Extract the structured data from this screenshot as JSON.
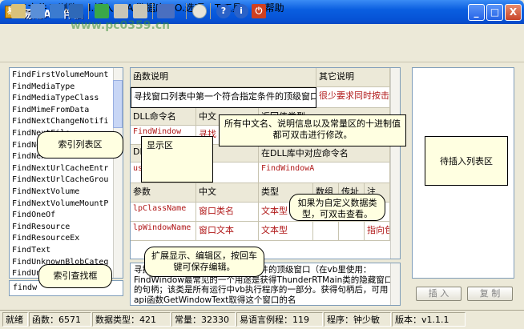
{
  "window": {
    "title": "易用API伴侣",
    "minimize": "_",
    "maximize": "□",
    "close": "X"
  },
  "menu": [
    "F.文件",
    "V.浏览",
    "I.插入",
    "A.数据库",
    "O.选项",
    "T.工具",
    "H.帮助"
  ],
  "watermark": "www.pc0359.cn",
  "index_list": [
    "FindFirstVolumeMount",
    "FindMediaType",
    "FindMediaTypeClass",
    "FindMimeFromData",
    "FindNextChangeNotifi",
    "FindNextFile",
    "FindNextFileA",
    "FindNextFileW",
    "FindNextUrlCacheEntr",
    "FindNextUrlCacheGrou",
    "FindNextVolume",
    "FindNextVolumeMountP",
    "FindOneOf",
    "FindResource",
    "FindResourceEx",
    "FindText",
    "FindUnknownBlobCateg",
    "FindUnknown"
  ],
  "search_value": "findw",
  "function_table": {
    "desc_header": "函数说明",
    "other_header": "其它说明",
    "desc_value": "寻找窗口列表中第一个符合指定条件的顶级窗口",
    "other_value": "很少要求同时按击",
    "dll_cmd_header": "DLL命令名",
    "cn_header": "中文",
    "return_header": "返回值类型",
    "dll_cmd_value": "FindWindow",
    "cn_value": "寻找",
    "dll_lib_header": "DLL",
    "dll_lib_value": "user",
    "dll_alias_header": "在DLL库中对应命令名",
    "dll_alias_value": "FindWindowA",
    "param_header": "参数",
    "param_cn_header": "中文",
    "type_header": "类型",
    "array_header": "数组",
    "addr_header": "传址",
    "note_header": "注",
    "params": [
      {
        "name": "lpClassName",
        "cn": "窗口类名",
        "type": "文本型",
        "note": ""
      },
      {
        "name": "lpWindowName",
        "cn": "窗口文本",
        "type": "文本型",
        "note": "指向包"
      }
    ]
  },
  "description_text": "寻找窗口列表中第一个符合指定条件的顶级窗口（在vb里使用：FindWindow最常见的一个用途是获得ThunderRTMain类的隐藏窗口的句柄；该类是所有运行中vb执行程序的一部分。获得句柄后，可用api函数GetWindowText取得这个窗口的名",
  "buttons": {
    "insert": "插 入",
    "copy": "复 制"
  },
  "status": {
    "ready": "就绪",
    "functions": "函数：6571",
    "types": "数据类型：421",
    "constants": "常量：32330",
    "samples": "易语言例程：119",
    "author": "程序：钟少敏",
    "version": "版本：v1.1.1"
  },
  "callouts": {
    "index_list": "索引列表区",
    "display": "显示区",
    "edit_note": "所有中文名、说明信息以及常量区的十进制值都可双击进行修改。",
    "insert_list": "待插入列表区",
    "custom_type": "如果为自定义数据类型，可双击查看。",
    "expand_edit": "扩展显示、编辑区，按回车键可保存编辑。",
    "index_search": "索引查找框"
  }
}
